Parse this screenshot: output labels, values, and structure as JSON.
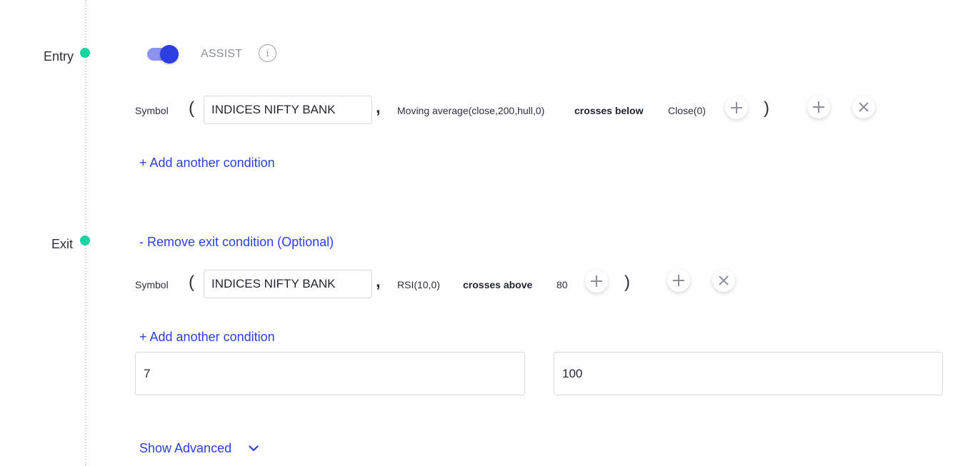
{
  "entry": {
    "label": "Entry",
    "assist_label": "ASSIST",
    "assist_enabled": true,
    "info_icon": "info-icon",
    "condition": {
      "symbol_label": "Symbol",
      "open_paren": "(",
      "symbol_value": "INDICES NIFTY BANK",
      "comma": ",",
      "indicator": "Moving average(close,200,hull,0)",
      "operator": "crosses below",
      "comparator": "Close(0)",
      "close_paren": ")"
    },
    "add_condition_label": "+ Add another condition"
  },
  "exit": {
    "label": "Exit",
    "remove_label": "- Remove exit condition (Optional)",
    "condition": {
      "symbol_label": "Symbol",
      "open_paren": "(",
      "symbol_value": "INDICES NIFTY BANK",
      "comma": ",",
      "indicator": "RSI(10,0)",
      "operator": "crosses above",
      "comparator": "80",
      "close_paren": ")"
    },
    "add_condition_label": "+ Add another condition",
    "stop_loss_value": "7",
    "target_value": "100"
  },
  "show_advanced_label": "Show Advanced",
  "colors": {
    "accent": "#2c3fe0",
    "dot": "#19d3a2",
    "toggle_track": "#8c93ee",
    "muted_text": "#8a8f99"
  }
}
